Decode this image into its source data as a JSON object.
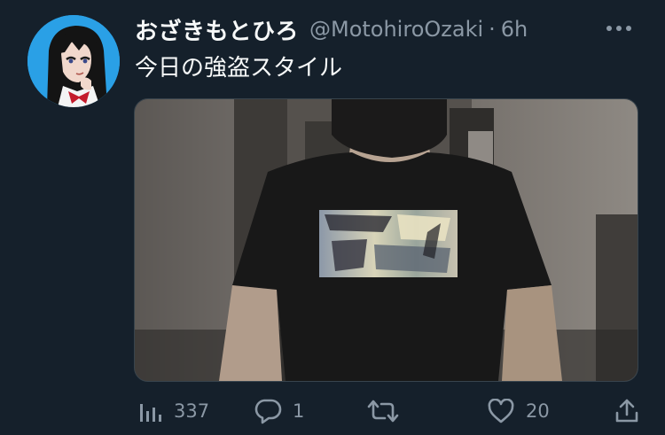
{
  "tweet": {
    "display_name": "おざきもとひろ",
    "handle": "@MotohiroOzaki",
    "separator": "·",
    "time": "6h",
    "text": "今日の強盗スタイル"
  },
  "actions": {
    "views": {
      "icon": "views-bar-chart-icon",
      "count": "337"
    },
    "reply": {
      "icon": "reply-bubble-icon",
      "count": "1"
    },
    "retweet": {
      "icon": "retweet-arrows-icon",
      "count": ""
    },
    "like": {
      "icon": "heart-icon",
      "count": "20"
    },
    "share": {
      "icon": "share-upload-icon"
    }
  },
  "colors": {
    "background": "#15202b",
    "primary_text": "#f7f9f9",
    "secondary_text": "#8b98a5",
    "border": "#38444d",
    "avatar_bg": "#2aa0e6"
  }
}
